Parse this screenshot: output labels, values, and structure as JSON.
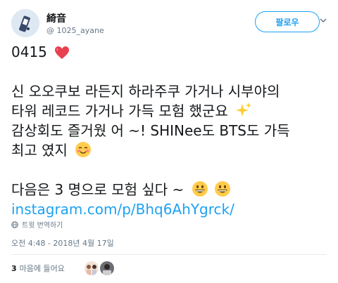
{
  "user": {
    "display_name": "綺音",
    "handle": "@ 1025_ayane"
  },
  "follow_button": {
    "label": "팔로우"
  },
  "tweet": {
    "line1": "0415",
    "line2": "신 오오쿠보 라든지 하라주쿠 가거나 시부야의",
    "line3": "타워 레코드 가거나 가득 모험 했군요",
    "line4": "감상회도 즐거웠 어 ~! SHINee도 BTS도 가득",
    "line5": "최고 였지",
    "line6": "다음은 3 명으로 모험 싶다 ~",
    "link": "instagram.com/p/Bhq6AhYgrck/"
  },
  "translate": {
    "label": "트윗 번역하기"
  },
  "timestamp": "오전 4:48 - 2018년 4월 17일",
  "likes": {
    "count": "3",
    "label": "마음에 들어요"
  },
  "icons": {
    "heart": "red-heart-emoji",
    "sparkles": "sparkles-emoji",
    "smile": "smiling-face-emoji",
    "grin": "grinning-face-emoji",
    "globe": "globe-icon",
    "chevron": "chevron-down-icon"
  },
  "colors": {
    "accent": "#1da1f2",
    "muted": "#657786",
    "text": "#14171a"
  }
}
